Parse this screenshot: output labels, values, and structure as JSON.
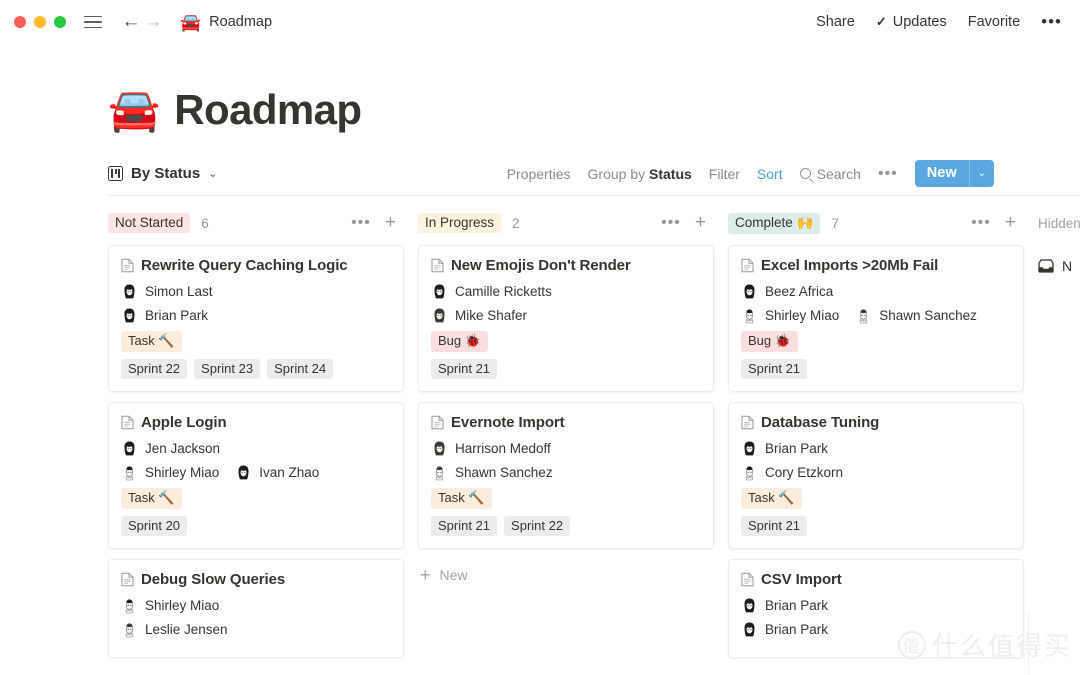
{
  "window": {
    "traffic_lights": [
      "close",
      "minimize",
      "maximize"
    ],
    "menu_icon": "hamburger-icon",
    "back_arrow": "←",
    "forward_arrow": "→",
    "breadcrumb_emoji": "🚘",
    "breadcrumb_title": "Roadmap",
    "actions": {
      "share": "Share",
      "updates": "Updates",
      "updates_check": "✓",
      "favorite": "Favorite",
      "more": "•••"
    }
  },
  "page": {
    "emoji": "🚘",
    "title": "Roadmap"
  },
  "viewbar": {
    "view_name": "By Status",
    "view_chevron": "⌄",
    "properties": "Properties",
    "group_by_prefix": "Group by ",
    "group_by_value": "Status",
    "filter": "Filter",
    "sort": "Sort",
    "search": "Search",
    "more": "•••",
    "new_label": "New",
    "new_chevron": "⌄",
    "accent_color": "#4a9fe0",
    "new_button_color": "#5ba7e0"
  },
  "columns": [
    {
      "label": "Not Started",
      "chip_class": "pink",
      "chip_color": "#fbe4e4",
      "count": "6",
      "more": "•••",
      "add": "+",
      "cards": [
        {
          "title": "Rewrite Query Caching Logic",
          "people_rows": [
            [
              {
                "name": "Simon Last",
                "avatar": "avatar-simon-last"
              }
            ],
            [
              {
                "name": "Brian Park",
                "avatar": "avatar-brian-park"
              }
            ]
          ],
          "type_tag": {
            "label": "Task 🔨",
            "style": "cream"
          },
          "sprints": [
            "Sprint 22",
            "Sprint 23",
            "Sprint 24"
          ]
        },
        {
          "title": "Apple Login",
          "people_rows": [
            [
              {
                "name": "Jen Jackson",
                "avatar": "avatar-jen-jackson"
              }
            ],
            [
              {
                "name": "Shirley Miao",
                "avatar": "avatar-shirley-miao"
              },
              {
                "name": "Ivan Zhao",
                "avatar": "avatar-ivan-zhao"
              }
            ]
          ],
          "type_tag": {
            "label": "Task 🔨",
            "style": "cream"
          },
          "sprints": [
            "Sprint 20"
          ]
        },
        {
          "title": "Debug Slow Queries",
          "people_rows": [
            [
              {
                "name": "Shirley Miao",
                "avatar": "avatar-shirley-miao"
              }
            ],
            [
              {
                "name": "Leslie Jensen",
                "avatar": "avatar-leslie-jensen"
              }
            ]
          ],
          "type_tag": null,
          "sprints": []
        }
      ],
      "new_row": null
    },
    {
      "label": "In Progress",
      "chip_class": "cream",
      "chip_color": "#fbf3db",
      "count": "2",
      "more": "•••",
      "add": "+",
      "cards": [
        {
          "title": "New Emojis Don't Render",
          "people_rows": [
            [
              {
                "name": "Camille Ricketts",
                "avatar": "avatar-camille-ricketts"
              }
            ],
            [
              {
                "name": "Mike Shafer",
                "avatar": "avatar-mike-shafer"
              }
            ]
          ],
          "type_tag": {
            "label": "Bug 🐞",
            "style": "pink"
          },
          "sprints": [
            "Sprint 21"
          ]
        },
        {
          "title": "Evernote Import",
          "people_rows": [
            [
              {
                "name": "Harrison Medoff",
                "avatar": "avatar-harrison-medoff"
              }
            ],
            [
              {
                "name": "Shawn Sanchez",
                "avatar": "avatar-shawn-sanchez"
              }
            ]
          ],
          "type_tag": {
            "label": "Task 🔨",
            "style": "cream"
          },
          "sprints": [
            "Sprint 21",
            "Sprint 22"
          ]
        }
      ],
      "new_row": "New"
    },
    {
      "label": "Complete 🙌",
      "chip_class": "green",
      "chip_color": "#ddedea",
      "count": "7",
      "more": "•••",
      "add": "+",
      "cards": [
        {
          "title": "Excel Imports >20Mb Fail",
          "people_rows": [
            [
              {
                "name": "Beez Africa",
                "avatar": "avatar-beez-africa"
              }
            ],
            [
              {
                "name": "Shirley Miao",
                "avatar": "avatar-shirley-miao"
              },
              {
                "name": "Shawn Sanchez",
                "avatar": "avatar-shawn-sanchez"
              }
            ]
          ],
          "type_tag": {
            "label": "Bug 🐞",
            "style": "pink"
          },
          "sprints": [
            "Sprint 21"
          ]
        },
        {
          "title": "Database Tuning",
          "people_rows": [
            [
              {
                "name": "Brian Park",
                "avatar": "avatar-brian-park"
              }
            ],
            [
              {
                "name": "Cory Etzkorn",
                "avatar": "avatar-cory-etzkorn"
              }
            ]
          ],
          "type_tag": {
            "label": "Task 🔨",
            "style": "cream"
          },
          "sprints": [
            "Sprint 21"
          ]
        },
        {
          "title": "CSV Import",
          "people_rows": [
            [
              {
                "name": "Brian Park",
                "avatar": "avatar-brian-park"
              }
            ],
            [
              {
                "name": "Brian Park",
                "avatar": "avatar-brian-park"
              }
            ]
          ],
          "type_tag": null,
          "sprints": []
        }
      ],
      "new_row": null
    }
  ],
  "hidden_column": {
    "label": "Hidden",
    "item_icon": "inbox-icon",
    "item_label": "N"
  },
  "watermark": {
    "mark": "值",
    "text": "什么值得买"
  }
}
